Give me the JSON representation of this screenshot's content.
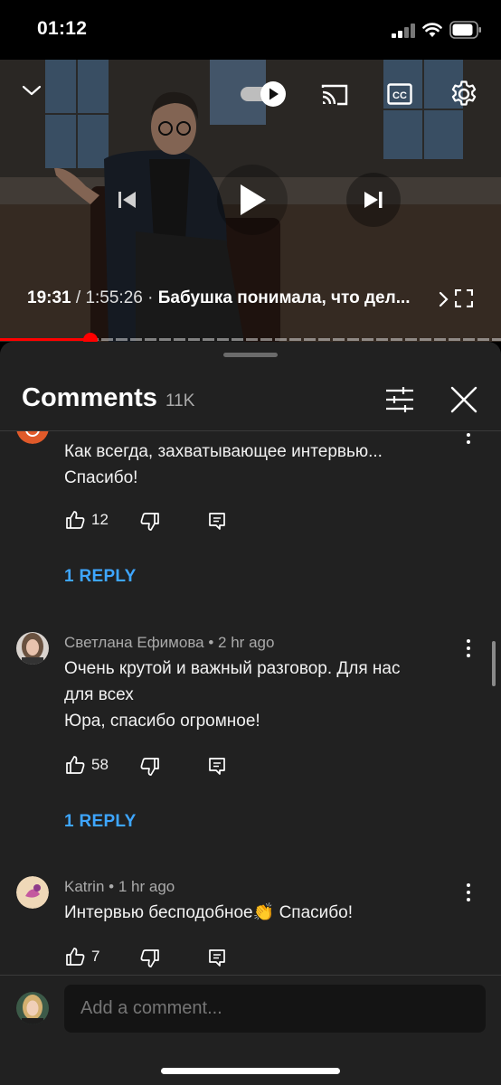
{
  "status_bar": {
    "time": "01:12"
  },
  "player": {
    "current_time": "19:31",
    "separator": "/",
    "duration": "1:55:26",
    "bullet": "·",
    "chapter_title": "Бабушка понимала, что дел...",
    "progress_fraction": 0.18,
    "autoplay": "on"
  },
  "comments_header": {
    "title": "Comments",
    "count": "11K"
  },
  "comments": [
    {
      "lines": [
        "Как всегда, захватывающее интервью...",
        "Спасибо!"
      ],
      "likes": "12",
      "reply_label": "1 REPLY",
      "avatar_color": "#e05a2a"
    },
    {
      "author": "Светлана Ефимова",
      "dot": "•",
      "time": "2 hr ago",
      "lines": [
        "Очень крутой и важный разговор. Для нас",
        "для всех",
        "Юра, спасибо огромное!"
      ],
      "likes": "58",
      "reply_label": "1 REPLY"
    },
    {
      "author": "Katrin",
      "dot": "•",
      "time": "1 hr ago",
      "lines": [
        "Интервью бесподобное👏 Спасибо!"
      ],
      "likes": "7"
    }
  ],
  "add_comment": {
    "placeholder": "Add a comment..."
  },
  "colors": {
    "accent_red": "#ff0000",
    "reply_blue": "#3ea6ff",
    "panel_bg": "#212121"
  }
}
